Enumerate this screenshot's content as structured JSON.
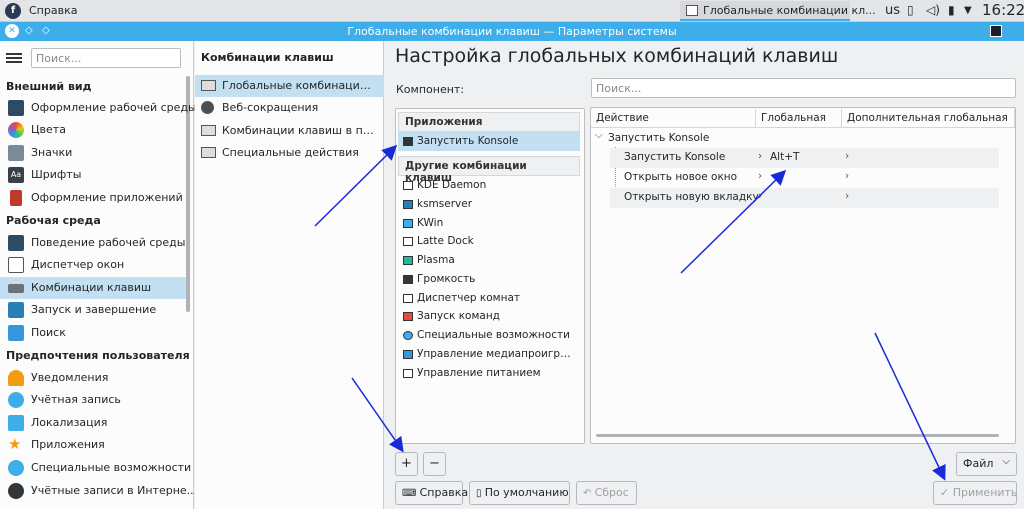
{
  "topbar": {
    "app_menu_label": "Справка",
    "task_label": "Глобальные комбинации кл...",
    "keyboard_layout": "us",
    "clock": "16:22"
  },
  "window": {
    "title": "Глобальные комбинации клавиш — Параметры системы"
  },
  "sidebar": {
    "search_placeholder": "Поиск...",
    "categories": [
      {
        "label": "Внешний вид"
      },
      {
        "label": "Рабочая среда"
      },
      {
        "label": "Предпочтения пользователя"
      }
    ],
    "items": [
      {
        "label": "Оформление рабочей среды",
        "icon": "desktop-theme-icon"
      },
      {
        "label": "Цвета",
        "icon": "colors-icon"
      },
      {
        "label": "Значки",
        "icon": "icons-icon"
      },
      {
        "label": "Шрифты",
        "icon": "fonts-icon"
      },
      {
        "label": "Оформление приложений",
        "icon": "app-style-icon"
      },
      {
        "label": "Поведение рабочей среды",
        "icon": "workspace-behavior-icon"
      },
      {
        "label": "Диспетчер окон",
        "icon": "window-manager-icon"
      },
      {
        "label": "Комбинации клавиш",
        "icon": "keyboard-icon"
      },
      {
        "label": "Запуск и завершение",
        "icon": "startup-icon"
      },
      {
        "label": "Поиск",
        "icon": "search-icon"
      },
      {
        "label": "Уведомления",
        "icon": "bell-icon"
      },
      {
        "label": "Учётная запись",
        "icon": "user-icon"
      },
      {
        "label": "Локализация",
        "icon": "locale-icon"
      },
      {
        "label": "Приложения",
        "icon": "star-icon"
      },
      {
        "label": "Специальные возможности",
        "icon": "accessibility-icon"
      },
      {
        "label": "Учётные записи в Интерне...",
        "icon": "online-accounts-icon"
      }
    ]
  },
  "midpanel": {
    "title": "Комбинации клавиш",
    "items": [
      {
        "label": "Глобальные комбинации кла..."
      },
      {
        "label": "Веб-сокращения"
      },
      {
        "label": "Комбинации клавиш в прил..."
      },
      {
        "label": "Специальные действия"
      }
    ]
  },
  "main": {
    "heading": "Настройка глобальных комбинаций клавиш",
    "component_label": "Компонент:",
    "search_placeholder": "Поиск...",
    "group_apps": "Приложения",
    "group_other": "Другие комбинации клавиш",
    "apps": [
      {
        "label": "Запустить Konsole"
      }
    ],
    "components": [
      {
        "label": "KDE Daemon"
      },
      {
        "label": "ksmserver"
      },
      {
        "label": "KWin"
      },
      {
        "label": "Latte Dock"
      },
      {
        "label": "Plasma"
      },
      {
        "label": "Громкость"
      },
      {
        "label": "Диспетчер комнат"
      },
      {
        "label": "Запуск команд"
      },
      {
        "label": "Специальные возможности"
      },
      {
        "label": "Управление медиапроигрыв..."
      },
      {
        "label": "Управление питанием"
      }
    ],
    "table": {
      "headers": [
        "Действие",
        "Глобальная",
        "Дополнительная глобальная"
      ],
      "group": "Запустить Konsole",
      "rows": [
        {
          "action": "Запустить Konsole",
          "global": "Alt+T"
        },
        {
          "action": "Открыть новое окно",
          "global": ""
        },
        {
          "action": "Открыть новую вкладку",
          "global": ""
        }
      ]
    },
    "add_label": "+",
    "remove_label": "−",
    "file_label": "Файл",
    "help_label": "Справка",
    "defaults_label": "По умолчанию",
    "reset_label": "Сброс",
    "apply_label": "Применить"
  },
  "colors": {
    "accent": "#3daee9",
    "selection": "#c2e0f2",
    "annotation_arrow": "#1a2bd6"
  }
}
